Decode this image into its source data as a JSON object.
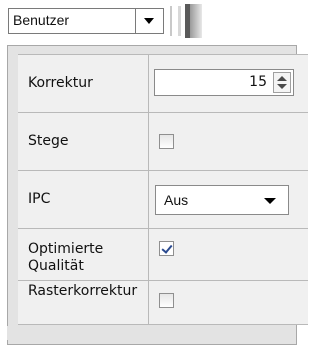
{
  "top_dropdown": {
    "value": "Benutzer"
  },
  "properties": [
    {
      "label": "Korrektur",
      "type": "spinner",
      "value": "15"
    },
    {
      "label": "Stege",
      "type": "checkbox",
      "checked": false
    },
    {
      "label": "IPC",
      "type": "dropdown",
      "value": "Aus"
    },
    {
      "label": "Optimierte Qualität",
      "type": "checkbox",
      "checked": true
    },
    {
      "label": "Rasterkorrektur",
      "type": "checkbox",
      "checked": false
    }
  ],
  "colors": {
    "panel_bg": "#e3e3e3",
    "row_bg": "#f0f0f0",
    "check_color": "#2b4a8f"
  }
}
